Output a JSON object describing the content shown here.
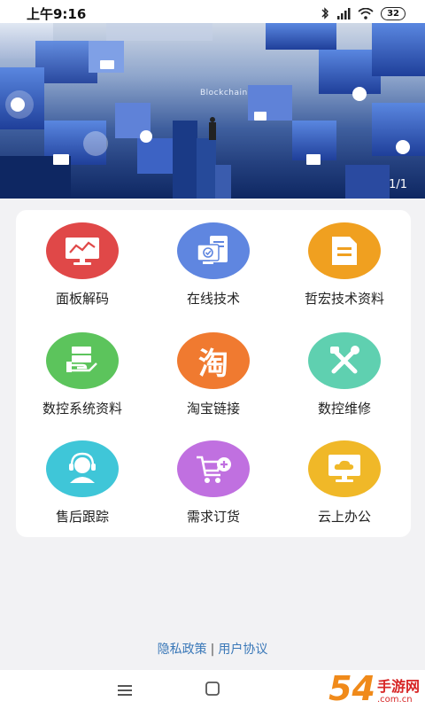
{
  "status": {
    "time": "上午9:16",
    "battery": "32"
  },
  "banner": {
    "caption": "Blockchain",
    "counter": "1/1"
  },
  "menu": {
    "items": [
      {
        "label": "面板解码",
        "icon": "monitor-chart-icon",
        "color": "#e04848"
      },
      {
        "label": "在线技术",
        "icon": "devices-check-icon",
        "color": "#5f86e0"
      },
      {
        "label": "哲宏技术资料",
        "icon": "document-icon",
        "color": "#f0a020"
      },
      {
        "label": "数控系统资料",
        "icon": "server-hand-icon",
        "color": "#5cc45c"
      },
      {
        "label": "淘宝链接",
        "icon": "taobao-icon",
        "color": "#f07a30"
      },
      {
        "label": "数控维修",
        "icon": "tools-icon",
        "color": "#5fd0b0"
      },
      {
        "label": "售后跟踪",
        "icon": "headset-user-icon",
        "color": "#3fc6d8"
      },
      {
        "label": "需求订货",
        "icon": "cart-add-icon",
        "color": "#c070e0"
      },
      {
        "label": "云上办公",
        "icon": "cloud-monitor-icon",
        "color": "#f0b828"
      }
    ]
  },
  "footer": {
    "privacy": "隐私政策",
    "separator": "|",
    "agreement": "用户协议"
  },
  "watermark": {
    "num": "54",
    "main": "手游网",
    "sub": ".com.cn"
  }
}
